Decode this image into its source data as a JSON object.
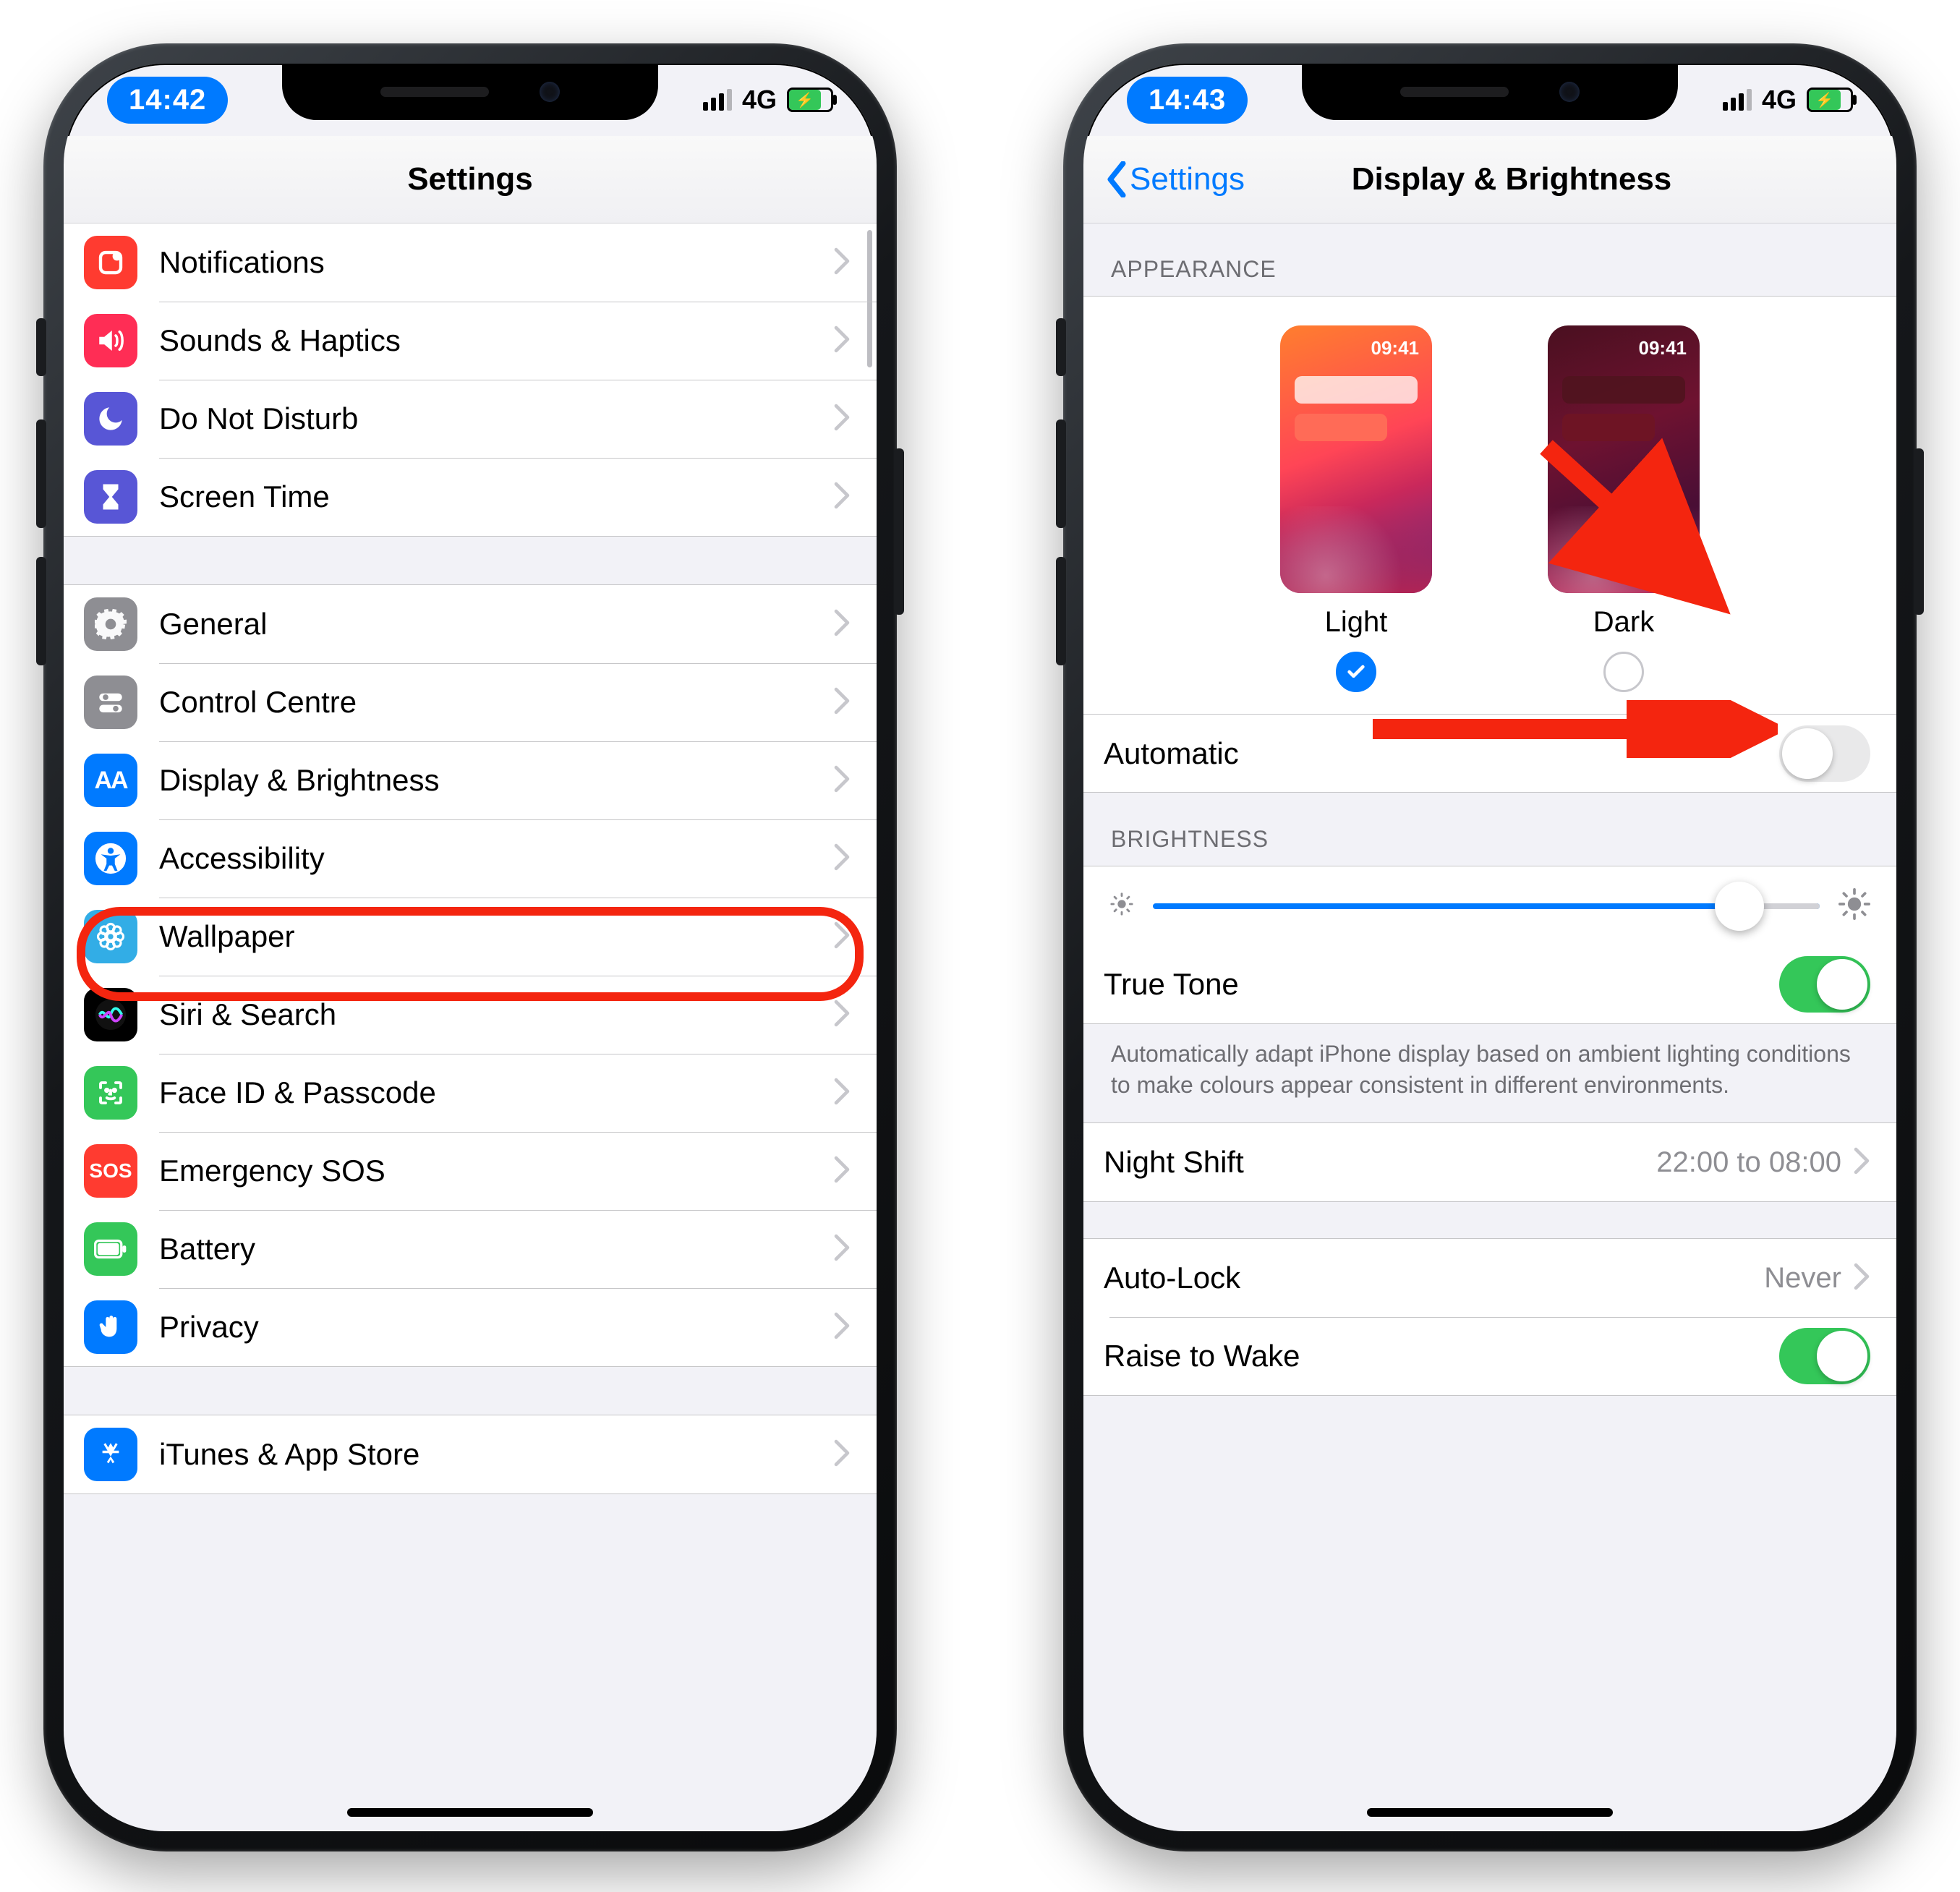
{
  "left": {
    "status": {
      "time": "14:42",
      "carrier": "4G"
    },
    "nav": {
      "title": "Settings"
    },
    "groups": [
      {
        "cells": [
          {
            "key": "notifications",
            "label": "Notifications",
            "icon": "notifications-icon",
            "icon_bg": "bg-red"
          },
          {
            "key": "sounds",
            "label": "Sounds & Haptics",
            "icon": "speaker-icon",
            "icon_bg": "bg-red2"
          },
          {
            "key": "dnd",
            "label": "Do Not Disturb",
            "icon": "moon-icon",
            "icon_bg": "bg-purple"
          },
          {
            "key": "screentime",
            "label": "Screen Time",
            "icon": "hourglass-icon",
            "icon_bg": "bg-purple"
          }
        ]
      },
      {
        "cells": [
          {
            "key": "general",
            "label": "General",
            "icon": "gear-icon",
            "icon_bg": "bg-gray"
          },
          {
            "key": "controlcentre",
            "label": "Control Centre",
            "icon": "toggles-icon",
            "icon_bg": "bg-gray"
          },
          {
            "key": "display",
            "label": "Display & Brightness",
            "icon": "textsize-icon",
            "icon_bg": "bg-blue",
            "highlight": true
          },
          {
            "key": "accessibility",
            "label": "Accessibility",
            "icon": "accessibility-icon",
            "icon_bg": "bg-blue"
          },
          {
            "key": "wallpaper",
            "label": "Wallpaper",
            "icon": "flower-icon",
            "icon_bg": "bg-sky"
          },
          {
            "key": "siri",
            "label": "Siri & Search",
            "icon": "siri-icon",
            "icon_bg": "bg-black"
          },
          {
            "key": "faceid",
            "label": "Face ID & Passcode",
            "icon": "faceid-icon",
            "icon_bg": "bg-green"
          },
          {
            "key": "sos",
            "label": "Emergency SOS",
            "icon": "sos-icon",
            "icon_bg": "bg-red"
          },
          {
            "key": "battery",
            "label": "Battery",
            "icon": "battery-icon",
            "icon_bg": "bg-green"
          },
          {
            "key": "privacy",
            "label": "Privacy",
            "icon": "hand-icon",
            "icon_bg": "bg-blue"
          }
        ]
      },
      {
        "cells": [
          {
            "key": "appstore",
            "label": "iTunes & App Store",
            "icon": "appstore-icon",
            "icon_bg": "bg-blue"
          }
        ]
      }
    ]
  },
  "right": {
    "status": {
      "time": "14:43",
      "carrier": "4G"
    },
    "nav": {
      "back": "Settings",
      "title": "Display & Brightness"
    },
    "appearance": {
      "header": "APPEARANCE",
      "preview_time": "09:41",
      "light_label": "Light",
      "dark_label": "Dark",
      "selected": "light",
      "automatic_label": "Automatic",
      "automatic_on": false
    },
    "brightness": {
      "header": "BRIGHTNESS",
      "level": 0.88,
      "truetone_label": "True Tone",
      "truetone_on": true,
      "truetone_note": "Automatically adapt iPhone display based on ambient lighting conditions to make colours appear consistent in different environments."
    },
    "nightshift": {
      "label": "Night Shift",
      "detail": "22:00 to 08:00"
    },
    "autolock": {
      "label": "Auto-Lock",
      "detail": "Never"
    },
    "raise": {
      "label": "Raise to Wake",
      "on": true
    }
  }
}
